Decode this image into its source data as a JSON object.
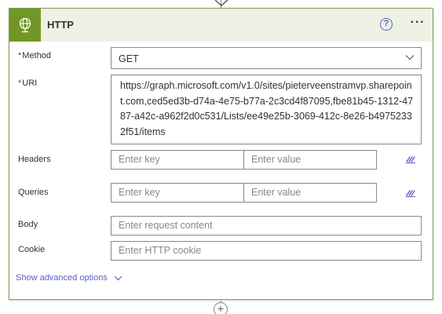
{
  "action": {
    "title": "HTTP",
    "header_color": "#709727",
    "icons": {
      "action": "globe-icon",
      "help": "help-icon",
      "more": "more-options-icon"
    },
    "help_symbol": "?",
    "more_symbol": "···"
  },
  "fields": {
    "method": {
      "label": "Method",
      "required_marker": "*",
      "value": "GET"
    },
    "uri": {
      "label": "URI",
      "required_marker": "*",
      "value": "https://graph.microsoft.com/v1.0/sites/pieterveenstramvp.sharepoint.com,ced5ed3b-d74a-4e75-b77a-2c3cd4f87095,fbe81b45-1312-4787-a42c-a962f2d0c531/Lists/ee49e25b-3069-412c-8e26-b49752332f51/items"
    },
    "headers": {
      "label": "Headers",
      "key_placeholder": "Enter key",
      "value_placeholder": "Enter value"
    },
    "queries": {
      "label": "Queries",
      "key_placeholder": "Enter key",
      "value_placeholder": "Enter value"
    },
    "body": {
      "label": "Body",
      "placeholder": "Enter request content"
    },
    "cookie": {
      "label": "Cookie",
      "placeholder": "Enter HTTP cookie"
    }
  },
  "advanced_options": {
    "label": "Show advanced options"
  },
  "add_step_symbol": "+"
}
